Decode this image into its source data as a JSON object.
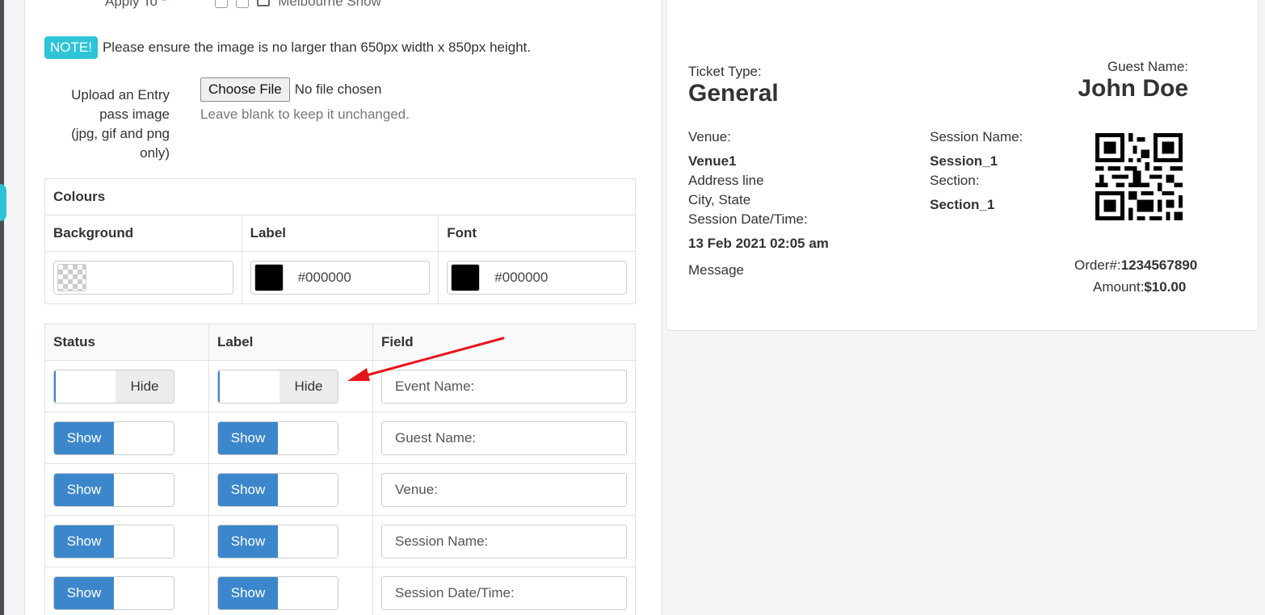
{
  "form": {
    "apply_to": {
      "label": "Apply To",
      "required_mark": "*",
      "option": "Melbourne Show"
    },
    "note": {
      "badge": "NOTE!",
      "text": "Please ensure the image is no larger than 650px width x 850px height."
    },
    "upload": {
      "label_lines": [
        "Upload an Entry",
        "pass image",
        "(jpg, gif and png",
        "only)"
      ],
      "button": "Choose File",
      "status": "No file chosen",
      "help": "Leave blank to keep it unchanged."
    },
    "colours": {
      "title": "Colours",
      "columns": [
        "Background",
        "Label",
        "Font"
      ],
      "values": [
        "",
        "#000000",
        "#000000"
      ],
      "swatches": [
        "transparent",
        "#000000",
        "#000000"
      ]
    },
    "fields_table": {
      "headers": [
        "Status",
        "Label",
        "Field"
      ],
      "rows": [
        {
          "status": "Hide",
          "label": "Hide",
          "field": "Event Name:"
        },
        {
          "status": "Show",
          "label": "Show",
          "field": "Guest Name:"
        },
        {
          "status": "Show",
          "label": "Show",
          "field": "Venue:"
        },
        {
          "status": "Show",
          "label": "Show",
          "field": "Session Name:"
        },
        {
          "status": "Show",
          "label": "Show",
          "field": "Session Date/Time:"
        }
      ]
    }
  },
  "ticket": {
    "ticket_type_label": "Ticket Type:",
    "ticket_type": "General",
    "guest_name_label": "Guest Name:",
    "guest_name": "John Doe",
    "venue_label": "Venue:",
    "venue": "Venue1",
    "address": "Address line",
    "city": "City, State",
    "session_datetime_label": "Session Date/Time:",
    "session_datetime": "13 Feb 2021 02:05 am",
    "message": "Message",
    "session_name_label": "Session Name:",
    "session_name": "Session_1",
    "section_label": "Section:",
    "section": "Section_1",
    "order_label": "Order#:",
    "order": "1234567890",
    "amount_label": "Amount:",
    "amount": "$10.00"
  },
  "colors": {
    "accent": "#2ec4d6",
    "toggle_on": "#3c87cc",
    "arrow": "#e8141b"
  }
}
